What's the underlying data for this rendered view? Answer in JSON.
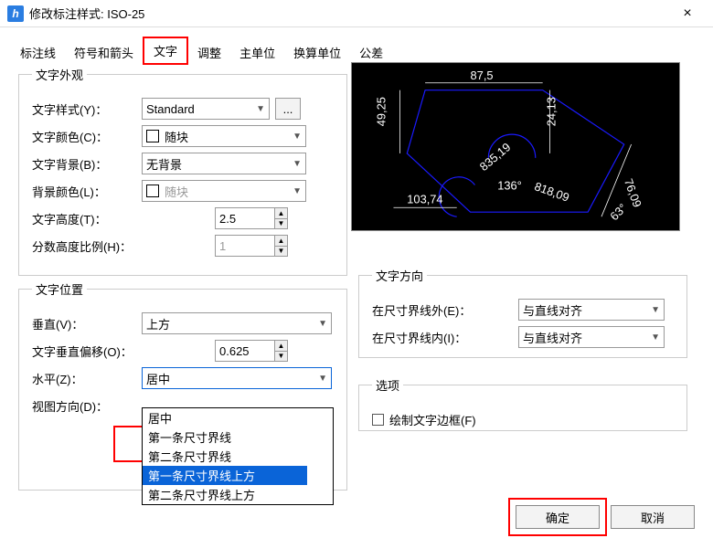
{
  "window": {
    "title": "修改标注样式: ISO-25",
    "close": "×"
  },
  "tabs": {
    "t1": "标注线",
    "t2": "符号和箭头",
    "t3": "文字",
    "t4": "调整",
    "t5": "主单位",
    "t6": "换算单位",
    "t7": "公差"
  },
  "group_appearance": {
    "title": "文字外观",
    "style_label": "文字样式(Y)：",
    "style_value": "Standard",
    "color_label": "文字颜色(C)：",
    "color_value": "随块",
    "bg_label": "文字背景(B)：",
    "bg_value": "无背景",
    "bgcolor_label": "背景颜色(L)：",
    "bgcolor_value": "随块",
    "height_label": "文字高度(T)：",
    "height_value": "2.5",
    "frac_label": "分数高度比例(H)：",
    "frac_value": "1"
  },
  "group_position": {
    "title": "文字位置",
    "vert_label": "垂直(V)：",
    "vert_value": "上方",
    "offset_label": "文字垂直偏移(O)：",
    "offset_value": "0.625",
    "horiz_label": "水平(Z)：",
    "horiz_value": "居中",
    "view_label": "视图方向(D)：",
    "horiz_options": [
      "居中",
      "第一条尺寸界线",
      "第二条尺寸界线",
      "第一条尺寸界线上方",
      "第二条尺寸界线上方"
    ]
  },
  "group_direction": {
    "title": "文字方向",
    "outside_label": "在尺寸界线外(E)：",
    "outside_value": "与直线对齐",
    "inside_label": "在尺寸界线内(I)：",
    "inside_value": "与直线对齐"
  },
  "group_option": {
    "title": "选项",
    "frame_label": "绘制文字边框(F)"
  },
  "preview": {
    "d1": "87,5",
    "d2": "49,25",
    "d3": "24,13",
    "d4": "76,09",
    "d5": "835,19",
    "d6": "136°",
    "d7": "818,09",
    "d8": "103,74",
    "d9": "63°"
  },
  "buttons": {
    "ok": "确定",
    "cancel": "取消"
  }
}
